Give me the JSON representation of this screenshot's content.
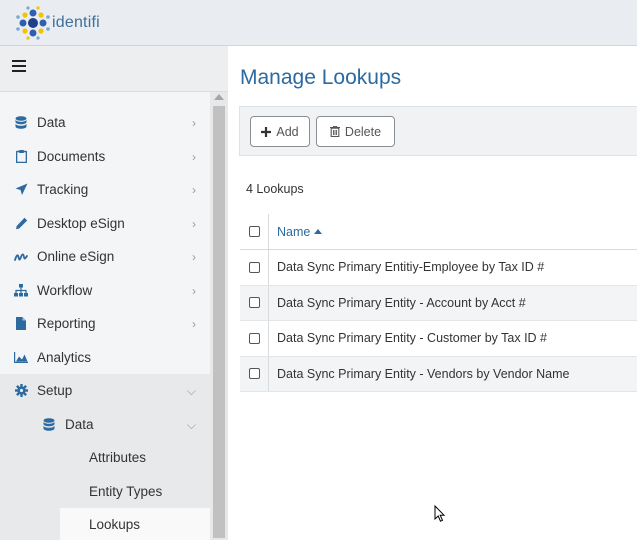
{
  "app": {
    "logo_text": "identifi"
  },
  "sidebar": {
    "menu_icon": "hamburger-icon",
    "items": [
      {
        "label": "Data",
        "icon": "database-icon",
        "has_arrow": true
      },
      {
        "label": "Documents",
        "icon": "clipboard-icon",
        "has_arrow": true
      },
      {
        "label": "Tracking",
        "icon": "location-arrow-icon",
        "has_arrow": true
      },
      {
        "label": "Desktop eSign",
        "icon": "pencil-icon",
        "has_arrow": true
      },
      {
        "label": "Online eSign",
        "icon": "signature-icon",
        "has_arrow": true
      },
      {
        "label": "Workflow",
        "icon": "sitemap-icon",
        "has_arrow": true
      },
      {
        "label": "Reporting",
        "icon": "file-icon",
        "has_arrow": true
      },
      {
        "label": "Analytics",
        "icon": "area-chart-icon",
        "has_arrow": false
      },
      {
        "label": "Setup",
        "icon": "cog-icon",
        "has_arrow": true,
        "expanded": true
      }
    ],
    "setup_children": [
      {
        "label": "Data",
        "icon": "database-icon",
        "expanded": true,
        "children": [
          "Attributes",
          "Entity Types",
          "Lookups"
        ]
      }
    ],
    "active_item": "Lookups"
  },
  "main": {
    "title": "Manage Lookups",
    "toolbar": {
      "add_label": "Add",
      "delete_label": "Delete"
    },
    "count_text": "4 Lookups",
    "grid": {
      "column_name": "Name",
      "sort": "ascending",
      "rows": [
        "Data Sync Primary Entitiy-Employee by Tax ID #",
        "Data Sync Primary Entity - Account by Acct #",
        "Data Sync Primary Entity - Customer by Tax ID #",
        "Data Sync Primary Entity - Vendors by Vendor Name"
      ]
    }
  },
  "colors": {
    "accent": "#2c6aa0",
    "topbar": "#e9edf1",
    "sidebar": "#f4f5f6"
  }
}
